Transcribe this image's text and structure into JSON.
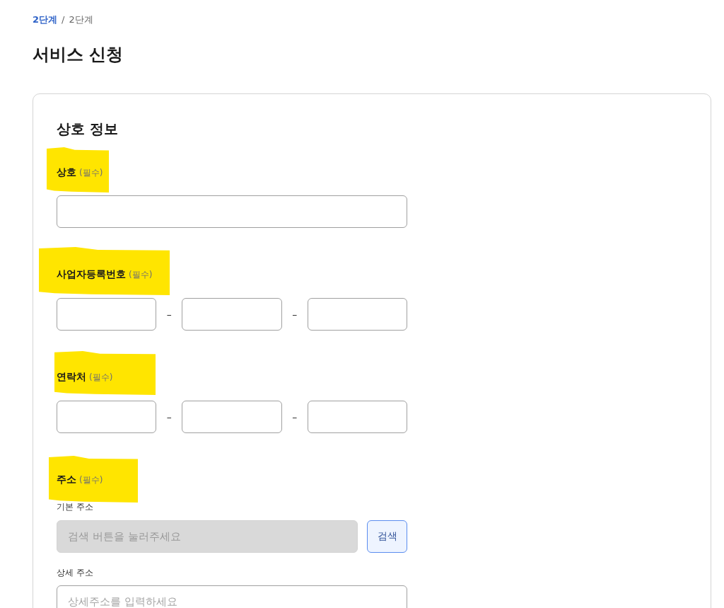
{
  "breadcrumb": {
    "separator": "/",
    "items": [
      {
        "label": "2단계",
        "kind": "link"
      },
      {
        "label": "2단계",
        "kind": "current"
      }
    ]
  },
  "page_title": "서비스 신청",
  "section": {
    "title": "상호 정보",
    "fields": [
      {
        "kind": "single",
        "label": "상호",
        "required_note": "(필수)",
        "highlighted": true
      },
      {
        "kind": "split",
        "label": "사업자등록번호",
        "required_note": "(필수)",
        "highlighted": true,
        "separators": [
          "–",
          "–"
        ]
      },
      {
        "kind": "split",
        "label": "연락처",
        "required_note": "(필수)",
        "highlighted": true,
        "separators": [
          "–",
          "–"
        ]
      },
      {
        "kind": "address",
        "label": "주소",
        "required_note": "(필수)",
        "highlighted": true,
        "subfields": [
          {
            "label": "기본 주소",
            "placeholder": "검색 버튼을 눌러주세요",
            "disabled": true,
            "button": "검색"
          },
          {
            "label": "상세 주소",
            "placeholder": "상세주소를 입력하세요",
            "disabled": false
          }
        ]
      }
    ]
  }
}
